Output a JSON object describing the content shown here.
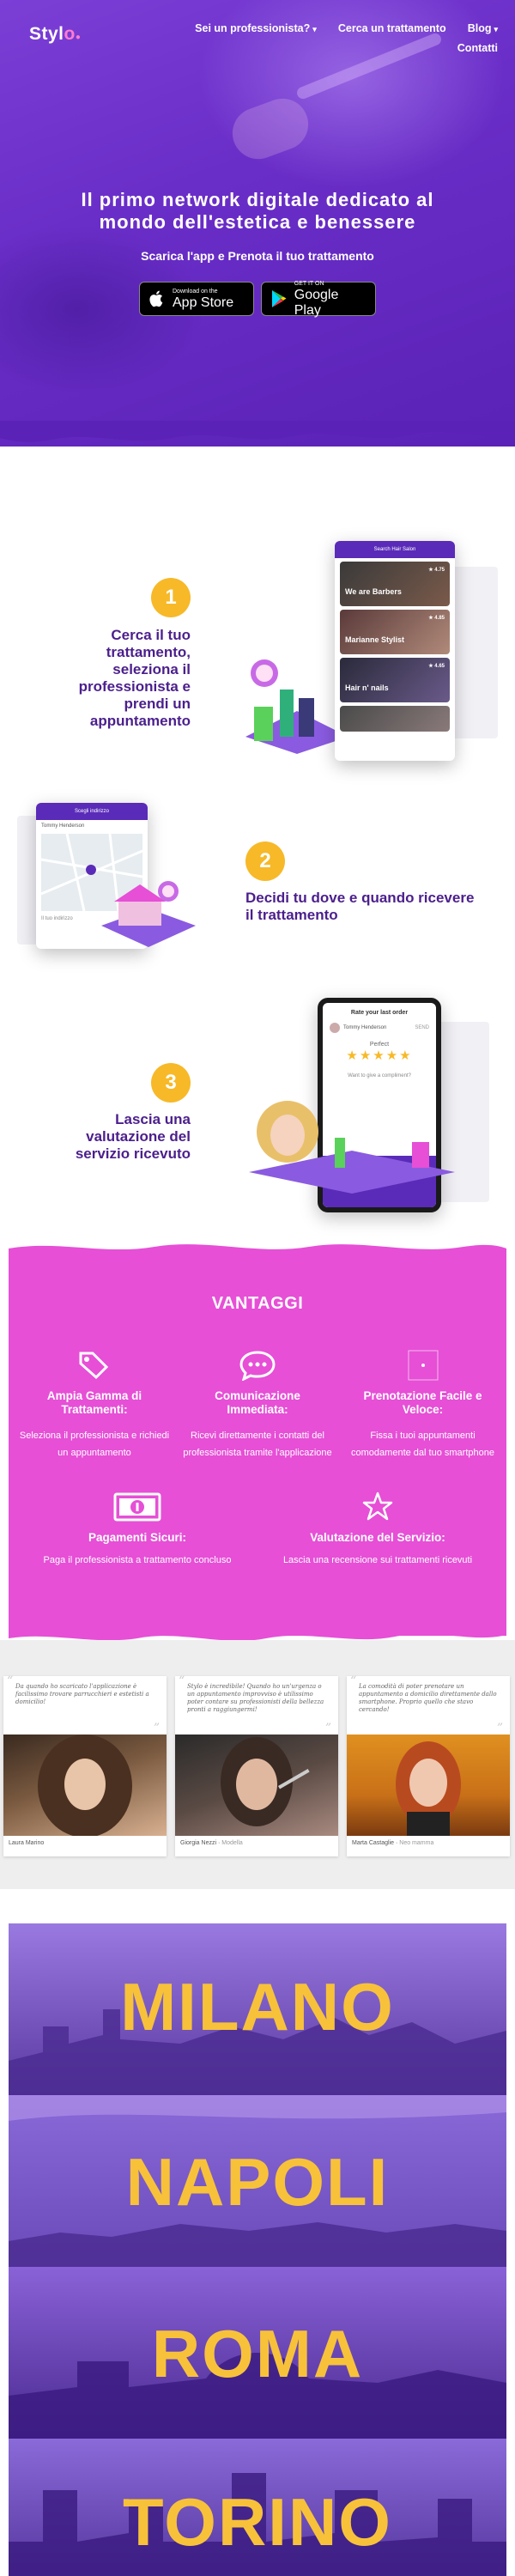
{
  "brand": {
    "logo_text": "Styl",
    "logo_accent": "o"
  },
  "nav": {
    "items": [
      {
        "label": "Sei un professionista?",
        "caret": "▾"
      },
      {
        "label": "Cerca un trattamento"
      },
      {
        "label": "Blog",
        "caret": "▾"
      },
      {
        "label": "Contatti"
      }
    ]
  },
  "hero": {
    "title_line1": "Il primo network digitale dedicato al",
    "title_line2": "mondo dell'estetica e benessere",
    "subtitle": "Scarica l'app e Prenota il tuo trattamento",
    "app_store": {
      "small": "Download on the",
      "big": "App Store"
    },
    "google_play": {
      "small": "GET IT ON",
      "big": "Google Play"
    }
  },
  "steps": [
    {
      "number": "1",
      "lines": [
        "Cerca il tuo",
        "trattamento,",
        "seleziona il",
        "professionista e",
        "prendi un",
        "appuntamento"
      ]
    },
    {
      "number": "2",
      "lines": [
        "Decidi tu dove e quando ricevere",
        "il trattamento"
      ]
    },
    {
      "number": "3",
      "lines": [
        "Lascia una",
        "valutazione del",
        "servizio ricevuto"
      ]
    }
  ],
  "phone1": {
    "bar": "Search Hair Salon",
    "cards": [
      {
        "title": "We are Barbers",
        "rating": "★ 4.75"
      },
      {
        "title": "Marianne Stylist",
        "rating": "★ 4.85"
      },
      {
        "title": "Hair n' nails",
        "rating": "★ 4.65"
      }
    ]
  },
  "phone2": {
    "bar": "Scegli indirizzo",
    "user": "Tommy Henderson",
    "address_label": "Il tuo indirizzo"
  },
  "phone3": {
    "title": "Rate your last order",
    "user": "Tommy Henderson",
    "badge": "SEND",
    "rating_label": "Perfect",
    "stars": "★★★★★",
    "prompt": "Want to give a compliment?"
  },
  "vantaggi": {
    "title": "VANTAGGI",
    "features": [
      {
        "title_line1": "Ampia Gamma di",
        "title_line2": "Trattamenti:",
        "desc_line1": "Seleziona il professionista e richiedi",
        "desc_line2": "un appuntamento",
        "icon": "tags-icon"
      },
      {
        "title_line1": "Comunicazione",
        "title_line2": "Immediata:",
        "desc_line1": "Ricevi direttamente i contatti del",
        "desc_line2": "professionista tramite l'applicazione",
        "icon": "chat-icon"
      },
      {
        "title_line1": "Prenotazione Facile e",
        "title_line2": "Veloce:",
        "desc_line1": "Fissa i tuoi appuntamenti",
        "desc_line2": "comodamente dal tuo smartphone",
        "icon": "calendar-icon"
      },
      {
        "title_line1": "Pagamenti Sicuri:",
        "title_line2": "",
        "desc_line1": "Paga il professionista a trattamento concluso",
        "desc_line2": "",
        "icon": "money-icon"
      },
      {
        "title_line1": "Valutazione del Servizio:",
        "title_line2": "",
        "desc_line1": "Lascia una recensione sui trattamenti ricevuti",
        "desc_line2": "",
        "icon": "star-icon"
      }
    ]
  },
  "testimonials": [
    {
      "quote": "Da quando ho scaricato l'applicazione è facilissimo trovare parrucchieri e estetisti a domicilio!",
      "name": "Laura Marino",
      "role": ""
    },
    {
      "quote": "Stylo è incredibile! Quando ho un'urgenza o un appuntamento improvviso è utilissimo poter contare su professionisti della bellezza pronti a raggiungermi!",
      "name": "Giorgia Nezzi",
      "role": "Modella"
    },
    {
      "quote": "La comodità di poter prenotare un appuntamento a domicilio direttamente dallo smartphone. Proprio quello che stavo cercando!",
      "name": "Marta Castaglie",
      "role": "Neo mamma"
    }
  ],
  "cities": [
    "MILANO",
    "NAPOLI",
    "ROMA",
    "TORINO"
  ],
  "colors": {
    "purple": "#6a2ec8",
    "magenta": "#e64fd6",
    "yellow": "#f7b928",
    "dark_purple": "#4b1f8c"
  }
}
